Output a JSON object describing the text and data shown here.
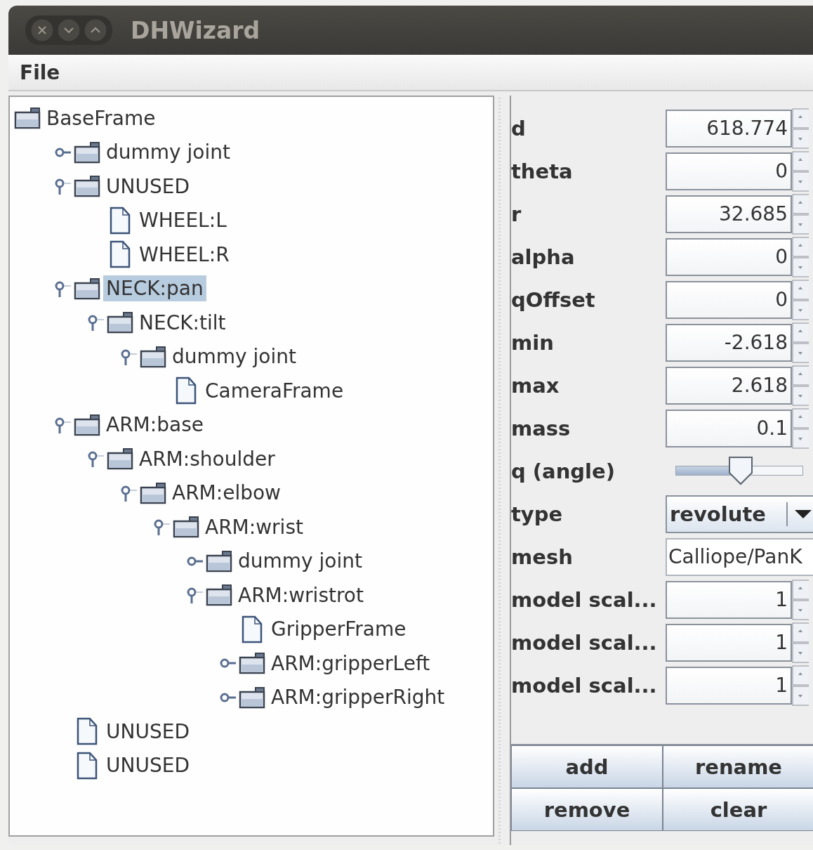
{
  "window": {
    "title": "DHWizard"
  },
  "menu": [
    "File"
  ],
  "tree": [
    {
      "label": "BaseFrame",
      "kind": "folder",
      "selected": false,
      "children": [
        {
          "label": "dummy joint",
          "kind": "folder",
          "expanded": false,
          "selected": false
        },
        {
          "label": "UNUSED",
          "kind": "folder",
          "expanded": true,
          "selected": false,
          "children": [
            {
              "label": "WHEEL:L",
              "kind": "file",
              "selected": false
            },
            {
              "label": "WHEEL:R",
              "kind": "file",
              "selected": false
            }
          ]
        },
        {
          "label": "NECK:pan",
          "kind": "folder",
          "expanded": true,
          "selected": true,
          "children": [
            {
              "label": "NECK:tilt",
              "kind": "folder",
              "expanded": true,
              "selected": false,
              "children": [
                {
                  "label": "dummy joint",
                  "kind": "folder",
                  "expanded": true,
                  "selected": false,
                  "children": [
                    {
                      "label": "CameraFrame",
                      "kind": "file",
                      "selected": false
                    }
                  ]
                }
              ]
            }
          ]
        },
        {
          "label": "ARM:base",
          "kind": "folder",
          "expanded": true,
          "selected": false,
          "children": [
            {
              "label": "ARM:shoulder",
              "kind": "folder",
              "expanded": true,
              "selected": false,
              "children": [
                {
                  "label": "ARM:elbow",
                  "kind": "folder",
                  "expanded": true,
                  "selected": false,
                  "children": [
                    {
                      "label": "ARM:wrist",
                      "kind": "folder",
                      "expanded": true,
                      "selected": false,
                      "children": [
                        {
                          "label": "dummy joint",
                          "kind": "folder",
                          "expanded": false,
                          "selected": false
                        },
                        {
                          "label": "ARM:wristrot",
                          "kind": "folder",
                          "expanded": true,
                          "selected": false,
                          "children": [
                            {
                              "label": "GripperFrame",
                              "kind": "file",
                              "selected": false
                            },
                            {
                              "label": "ARM:gripperLeft",
                              "kind": "folder",
                              "expanded": false,
                              "selected": false
                            },
                            {
                              "label": "ARM:gripperRight",
                              "kind": "folder",
                              "expanded": false,
                              "selected": false
                            }
                          ]
                        }
                      ]
                    }
                  ]
                }
              ]
            }
          ]
        },
        {
          "label": "UNUSED",
          "kind": "file",
          "selected": false
        },
        {
          "label": "UNUSED",
          "kind": "file",
          "selected": false
        }
      ]
    }
  ],
  "properties": [
    {
      "label": "d",
      "kind": "spinner",
      "value": "618.774"
    },
    {
      "label": "theta",
      "kind": "spinner",
      "value": "0"
    },
    {
      "label": "r",
      "kind": "spinner",
      "value": "32.685"
    },
    {
      "label": "alpha",
      "kind": "spinner",
      "value": "0"
    },
    {
      "label": "qOffset",
      "kind": "spinner",
      "value": "0"
    },
    {
      "label": "min",
      "kind": "spinner",
      "value": "-2.618"
    },
    {
      "label": "max",
      "kind": "spinner",
      "value": "2.618"
    },
    {
      "label": "mass",
      "kind": "spinner",
      "value": "0.1"
    },
    {
      "label": "q (angle)",
      "kind": "slider",
      "level": 0.51
    },
    {
      "label": "type",
      "kind": "combo",
      "value": "revolute"
    },
    {
      "label": "mesh",
      "kind": "text",
      "value": "Calliope/PanK"
    },
    {
      "label": "model scal...",
      "kind": "spinner",
      "value": "1"
    },
    {
      "label": "model scal...",
      "kind": "spinner",
      "value": "1"
    },
    {
      "label": "model scal...",
      "kind": "spinner",
      "value": "1"
    }
  ],
  "buttons": [
    "add",
    "rename",
    "remove",
    "clear"
  ]
}
